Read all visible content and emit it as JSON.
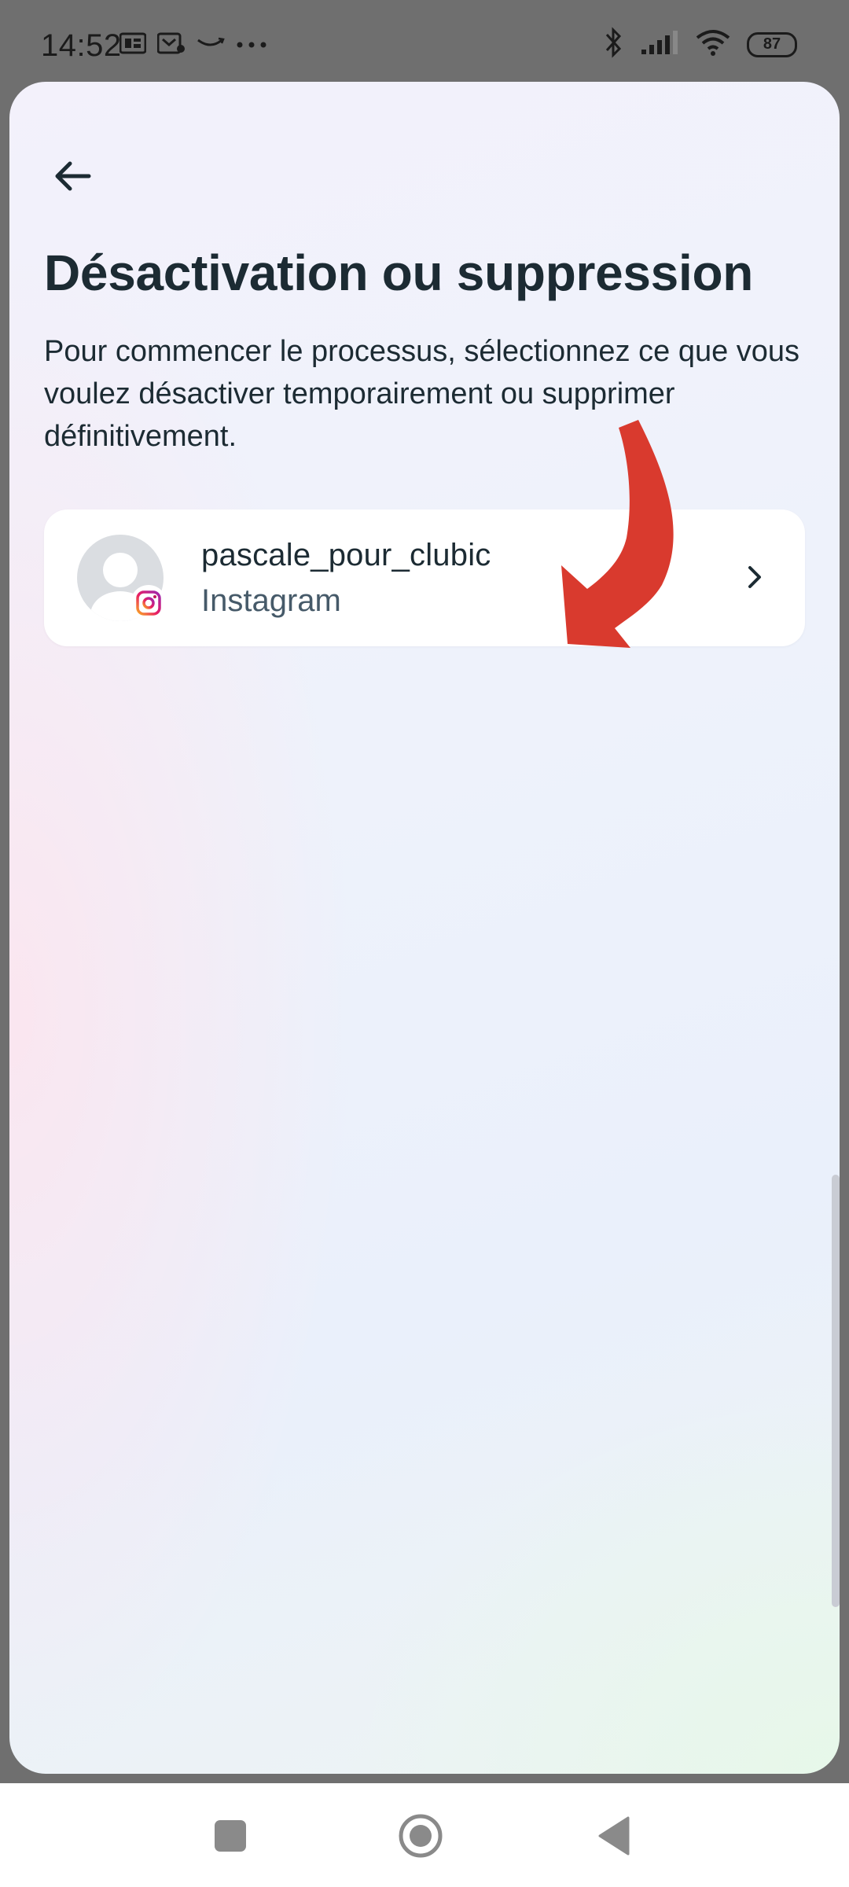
{
  "status_bar": {
    "time": "14:52",
    "battery": "87",
    "left_icons": [
      "sim-card-icon",
      "notification-icon",
      "amazon-icon",
      "more-dots-icon"
    ],
    "right_icons": [
      "bluetooth-icon",
      "signal-icon",
      "wifi-icon",
      "battery-icon"
    ]
  },
  "header": {
    "back_icon": "back-arrow-icon"
  },
  "page": {
    "title": "Désactivation ou suppression",
    "description": "Pour commencer le processus, sélectionnez ce que vous voulez désactiver temporairement ou supprimer définitivement."
  },
  "account": {
    "username": "pascale_pour_clubic",
    "platform": "Instagram",
    "badge_icon": "instagram-icon",
    "chevron_icon": "chevron-right-icon"
  },
  "annotation": {
    "icon": "red-curved-arrow",
    "color": "#d93a2e"
  },
  "nav_bar": {
    "items": [
      "recent-apps-icon",
      "home-icon",
      "back-icon"
    ]
  },
  "colors": {
    "text_primary": "#1c2b33",
    "text_secondary": "#465a69",
    "card": "#ffffff"
  }
}
